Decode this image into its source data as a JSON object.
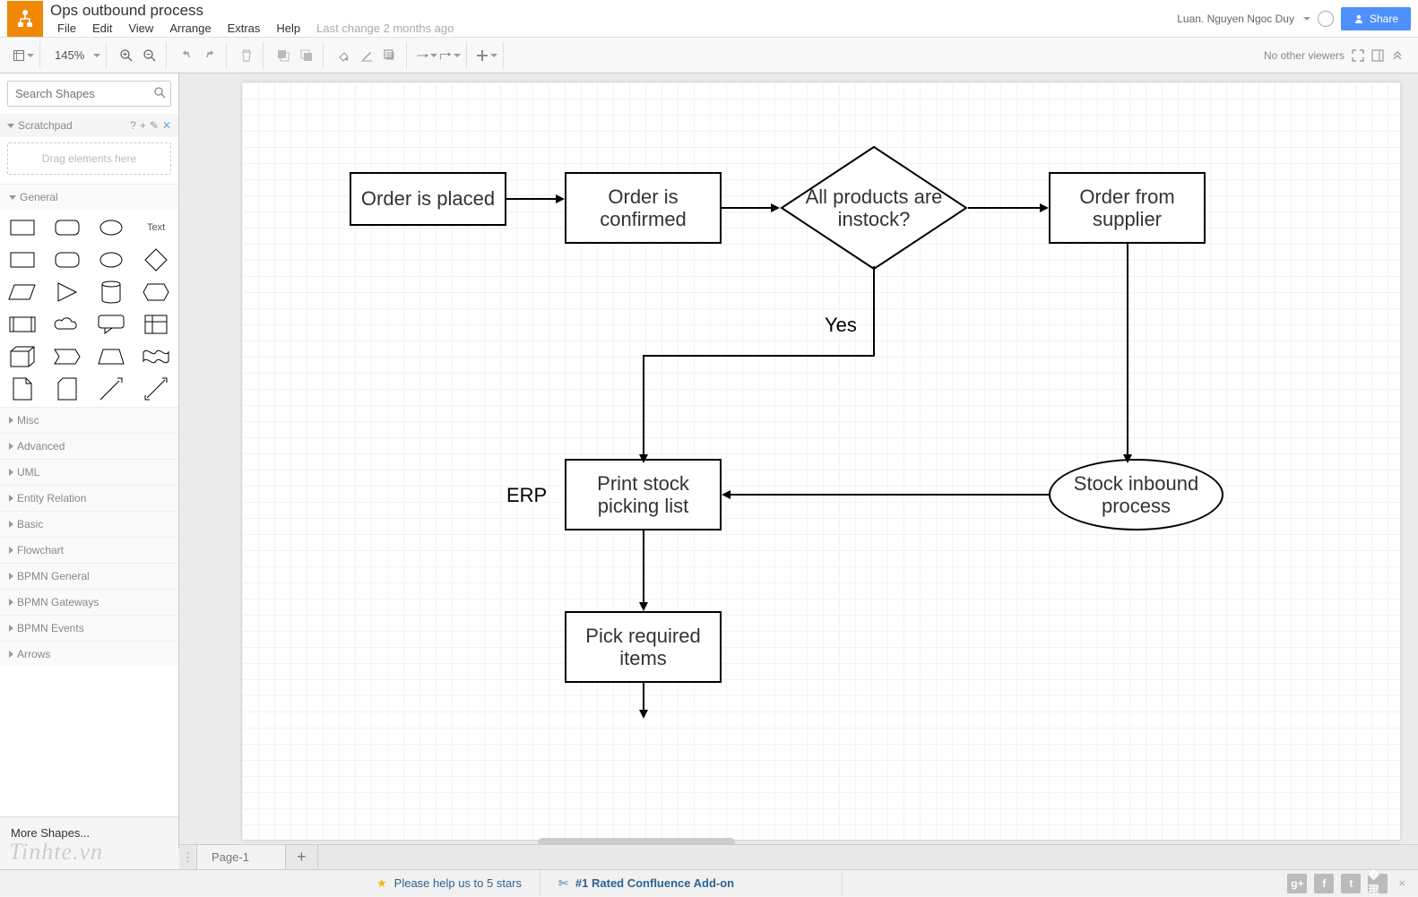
{
  "header": {
    "doc_title": "Ops outbound process",
    "menus": [
      "File",
      "Edit",
      "View",
      "Arrange",
      "Extras",
      "Help"
    ],
    "last_change": "Last change 2 months ago",
    "user_name": "Luan. Nguyen Ngoc Duy",
    "share_label": "Share"
  },
  "toolbar": {
    "zoom": "145%",
    "right_status": "No other viewers"
  },
  "sidebar": {
    "search_placeholder": "Search Shapes",
    "scratchpad_label": "Scratchpad",
    "scratchpad_drop": "Drag elements here",
    "general_label": "General",
    "text_shape_label": "Text",
    "collapsed_sections": [
      "Misc",
      "Advanced",
      "UML",
      "Entity Relation",
      "Basic",
      "Flowchart",
      "BPMN General",
      "BPMN Gateways",
      "BPMN Events",
      "Arrows"
    ],
    "more_shapes": "More Shapes..."
  },
  "canvas": {
    "nodes": {
      "order_placed": "Order is placed",
      "order_confirmed": "Order is confirmed",
      "decision_instock": "All products are instock?",
      "order_supplier": "Order from supplier",
      "print_picking": "Print stock picking list",
      "stock_inbound": "Stock inbound process",
      "pick_items": "Pick required items"
    },
    "labels": {
      "yes": "Yes",
      "erp": "ERP"
    }
  },
  "pages": {
    "page1": "Page-1"
  },
  "footer": {
    "rate_text": "Please help us to 5 stars",
    "confluence_text": "#1 Rated Confluence Add-on"
  },
  "watermark": "Tinhte.vn"
}
